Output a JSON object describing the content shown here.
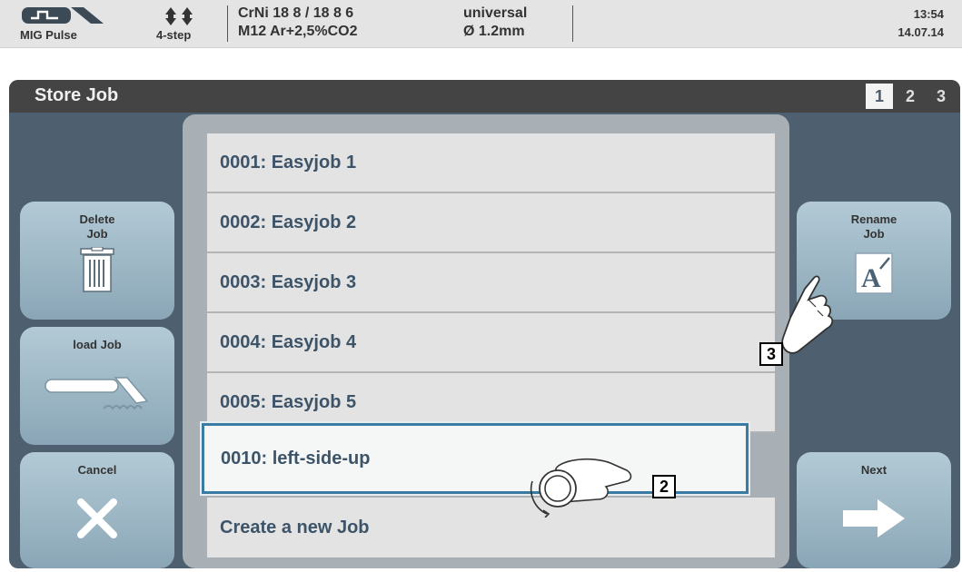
{
  "status": {
    "mode_label": "MIG Pulse",
    "step_label": "4-step",
    "material_line1": "CrNi 18 8 / 18 8 6",
    "material_line2": "M12 Ar+2,5%CO2",
    "wire_line1": "universal",
    "wire_line2": "Ø  1.2mm",
    "time": "13:54",
    "date": "14.07.14",
    "mode_icon": "mig-pulse-torch-icon",
    "step_icon": "four-step-arrows-icon"
  },
  "screen": {
    "title": "Store Job",
    "pages": [
      "1",
      "2",
      "3"
    ],
    "active_page": "1"
  },
  "left_buttons": {
    "delete": {
      "label": "Delete\nJob",
      "icon": "trash-icon"
    },
    "load": {
      "label": "load Job",
      "icon": "torch-icon"
    },
    "cancel": {
      "label": "Cancel",
      "icon": "x-icon"
    }
  },
  "right_buttons": {
    "rename": {
      "label": "Rename\nJob",
      "icon": "rename-icon"
    },
    "next": {
      "label": "Next",
      "icon": "arrow-right-icon"
    }
  },
  "jobs": [
    "0001: Easyjob 1",
    "0002: Easyjob 2",
    "0003: Easyjob 3",
    "0004: Easyjob 4",
    "0005: Easyjob 5"
  ],
  "selected_job": "0010: left-side-up",
  "create_job": "Create a new Job",
  "callouts": {
    "dial": "2",
    "touch": "3"
  },
  "colors": {
    "accent": "#3a7ba3",
    "button": "#9db7c5",
    "panel": "#4e6070",
    "text": "#3d5468"
  }
}
